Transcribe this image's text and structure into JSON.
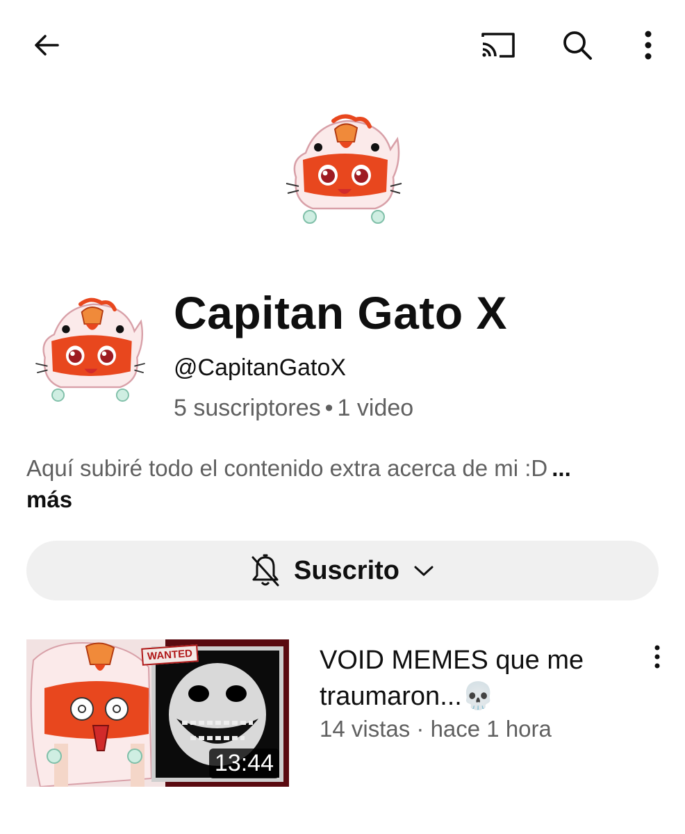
{
  "topbar": {
    "back_icon": "arrow-left-icon",
    "cast_icon": "cast-icon",
    "search_icon": "search-icon",
    "more_icon": "more-vertical-icon"
  },
  "channel": {
    "name": "Capitan Gato X",
    "handle": "@CapitanGatoX",
    "subscribers": "5 suscriptores",
    "separator": "•",
    "videos": "1 video",
    "description": "Aquí subiré todo el contenido extra acerca de mi :D",
    "ellipsis": "...",
    "more_label": "más"
  },
  "subscribe": {
    "label": "Suscrito",
    "bell_icon": "bell-off-icon",
    "chevron_icon": "chevron-down-icon"
  },
  "video": {
    "title": "VOID MEMES que me traumaron...💀",
    "views": "14 vistas",
    "meta_separator": "·",
    "age": "hace 1 hora",
    "duration": "13:44",
    "thumb_badge": "WANTED"
  },
  "colors": {
    "text_primary": "#0f0f0f",
    "text_secondary": "#606060",
    "button_bg": "#f0f0f0",
    "cat_orange": "#e8471e",
    "cat_red_eye": "#9e1b22"
  }
}
